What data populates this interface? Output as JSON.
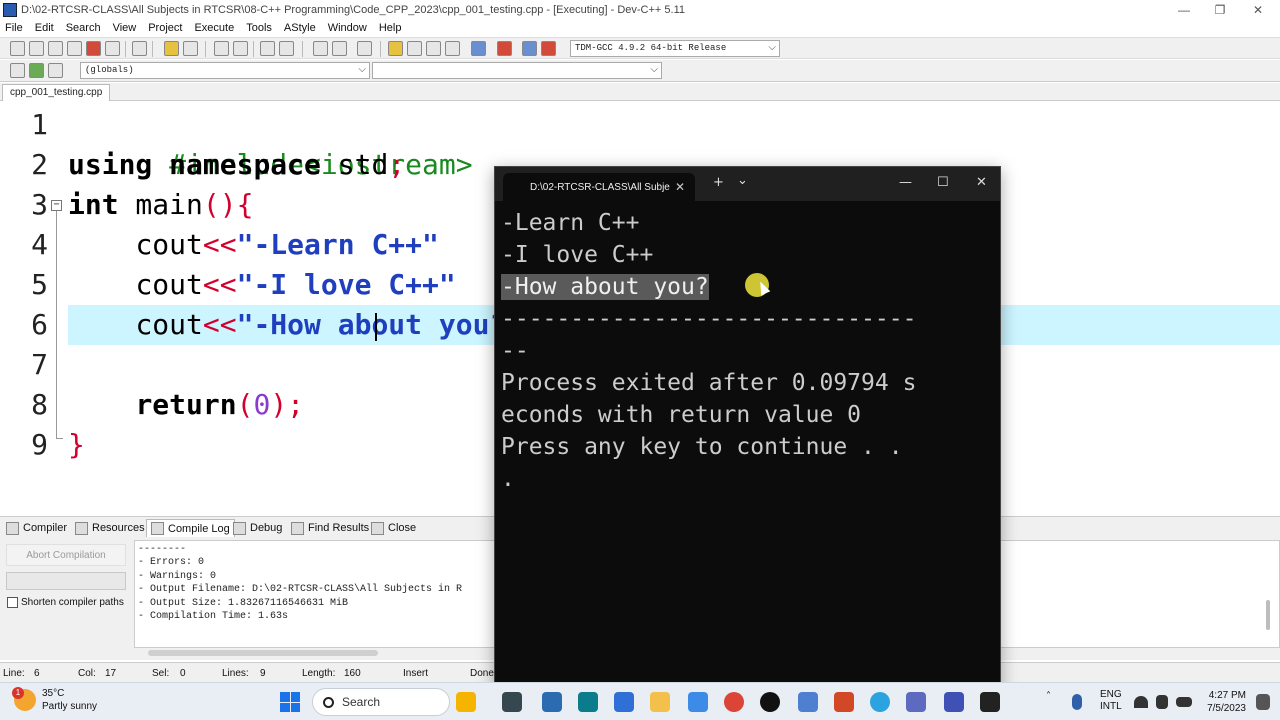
{
  "window": {
    "title": "D:\\02-RTCSR-CLASS\\All Subjects in RTCSR\\08-C++ Programming\\Code_CPP_2023\\cpp_001_testing.cpp - [Executing] - Dev-C++ 5.11",
    "minimize": "—",
    "maximize": "❐",
    "close": "✕"
  },
  "menu": [
    "File",
    "Edit",
    "Search",
    "View",
    "Project",
    "Execute",
    "Tools",
    "AStyle",
    "Window",
    "Help"
  ],
  "toolbar": {
    "compiler_select": "TDM-GCC 4.9.2 64-bit Release",
    "scope_select": "(globals)",
    "symbol_select": "",
    "dropdown_arrow": "⌵"
  },
  "file_tab": "cpp_001_testing.cpp",
  "editor": {
    "line_numbers": [
      "1",
      "2",
      "3",
      "4",
      "5",
      "6",
      "7",
      "8",
      "9"
    ],
    "fold_marker": "−",
    "lines": {
      "l1": {
        "pp": "#include<iostream>"
      },
      "l2": {
        "kw1": "using",
        "sp1": " ",
        "kw2": "namespace",
        "rest": " std",
        "semi": ";"
      },
      "l3": {
        "kw": "int",
        "name": " main",
        "parens": "(){"
      },
      "l4": {
        "indent": "    ",
        "cout": "cout",
        "op": "<<",
        "str": "\"-Learn C++\""
      },
      "l5": {
        "indent": "    ",
        "cout": "cout",
        "op": "<<",
        "str": "\"-I love C++\""
      },
      "l6": {
        "indent": "    ",
        "cout": "cout",
        "op": "<<",
        "str": "\"-How about you?\""
      },
      "l8": {
        "indent": "    ",
        "kw": "return",
        "op1": "(",
        "num": "0",
        "op2": ");"
      },
      "l9": {
        "brace": "}"
      }
    }
  },
  "bottom_tabs": {
    "compiler": "Compiler",
    "resources": "Resources",
    "compile_log": "Compile Log",
    "debug": "Debug",
    "find_results": "Find Results",
    "close": "Close"
  },
  "compile_panel": {
    "abort_button": "Abort Compilation",
    "shorten_paths_label": "Shorten compiler paths",
    "log_lines": [
      "--------",
      "- Errors: 0",
      "- Warnings: 0",
      "- Output Filename: D:\\02-RTCSR-CLASS\\All Subjects in R",
      "- Output Size: 1.83267116546631 MiB",
      "- Compilation Time: 1.63s"
    ]
  },
  "status": {
    "line_label": "Line:",
    "line_value": "6",
    "col_label": "Col:",
    "col_value": "17",
    "sel_label": "Sel:",
    "sel_value": "0",
    "lines_label": "Lines:",
    "lines_value": "9",
    "length_label": "Length:",
    "length_value": "160",
    "mode": "Insert",
    "state": "Done"
  },
  "console": {
    "tab_title": "D:\\02-RTCSR-CLASS\\All Subje",
    "tab_close": "✕",
    "new_tab": "+",
    "tab_menu": "⌄",
    "minimize": "—",
    "maximize": "☐",
    "close": "✕",
    "output": [
      "-Learn C++",
      "-I love C++",
      "-How about you?",
      "------------------------------",
      "--",
      "Process exited after 0.09794 s",
      "econds with return value 0",
      "Press any key to continue . .",
      "."
    ]
  },
  "taskbar": {
    "weather_badge": "1",
    "temperature": "35°C",
    "condition": "Partly sunny",
    "search_label": "Search",
    "lang_top": "ENG",
    "lang_bottom": "INTL",
    "time": "4:27 PM",
    "date": "7/5/2023",
    "tray_chevron": "˄"
  },
  "colors": {
    "current_line": "#ccf5ff",
    "keyword_string": "#1f3fbf",
    "operator": "#d1002c",
    "preprocessor": "#1a8a20",
    "number": "#8a3ad0",
    "console_bg": "#0c0c0c"
  }
}
